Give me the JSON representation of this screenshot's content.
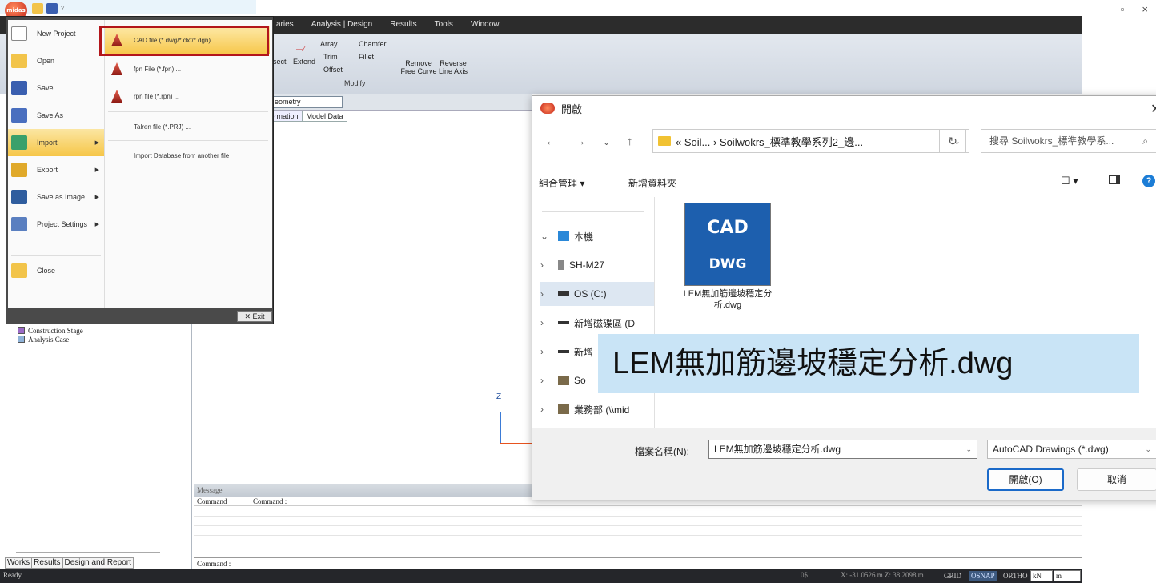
{
  "titlebar": {
    "qat_sep": "▿",
    "minimize": "–",
    "restore": "▫",
    "close": "×"
  },
  "app_logo": "midas",
  "menubar": [
    "aries",
    "Analysis | Design",
    "Results",
    "Tools",
    "Window"
  ],
  "ribbon": {
    "intersect": "rsect",
    "extend": "Extend",
    "array": "Array",
    "chamfer": "Chamfer",
    "trim": "Trim",
    "fillet": "Fillet",
    "offset": "Offset",
    "remove_free_curve": "Remove Free Curve",
    "reverse_line_axis": "Reverse Line Axis",
    "group": "Modify"
  },
  "geometry_select": "eometry",
  "tabs": [
    "formation",
    "Model Data"
  ],
  "app_menu": {
    "items": [
      "New Project",
      "Open",
      "Save",
      "Save As",
      "Import",
      "Export",
      "Save as Image",
      "Project Settings",
      "Close"
    ],
    "submenu": [
      "CAD file (*.dwg/*.dxf/*.dgn) ...",
      "fpn File (*.fpn) ...",
      "rpn file (*.rpn) ...",
      "Talren file (*.PRJ) ...",
      "Import Database from another file"
    ],
    "exit": "Exit"
  },
  "tree": [
    "Construction Stage",
    "Analysis Case"
  ],
  "bottom_tabs": [
    "Works",
    "Results",
    "Design and Report"
  ],
  "axis": {
    "z": "Z"
  },
  "message": {
    "header": "Message",
    "col1": "Command",
    "col2": "Command :",
    "cmd": "Command :"
  },
  "status": {
    "ready": "Ready",
    "zero": "0$",
    "coord": "X: -31.0526 m  Z: 38.2098 m",
    "grid": "GRID",
    "osnap": "OSNAP",
    "ortho": "ORTHO",
    "force_unit": "kN",
    "length_unit": "m"
  },
  "dialog": {
    "title": "開啟",
    "address": "«  Soil...  ›  Soilwokrs_標準教學系列2_邊...",
    "search_placeholder": "搜尋 Soilwokrs_標準教學系...",
    "organize": "組合管理 ▾",
    "new_folder": "新增資料夾",
    "nav": [
      {
        "label": "本機",
        "chev": "⌄"
      },
      {
        "label": "SH-M27",
        "chev": "›"
      },
      {
        "label": "OS (C:)",
        "chev": "›"
      },
      {
        "label": "新增磁碟區 (D",
        "chev": "›"
      },
      {
        "label": "新增",
        "chev": "›"
      },
      {
        "label": "So",
        "chev": "›"
      },
      {
        "label": "業務部 (\\\\mid",
        "chev": "›"
      }
    ],
    "file": {
      "icon_top": "CAD",
      "icon_bottom": "DWG",
      "name": "LEM無加筋邊坡穩定分析.dwg"
    },
    "filename_label": "檔案名稱(N):",
    "filename_value": "LEM無加筋邊坡穩定分析.dwg",
    "filetype": "AutoCAD Drawings (*.dwg)",
    "open": "開啟(O)",
    "cancel": "取消"
  },
  "callout": "LEM無加筋邊坡穩定分析.dwg",
  "colors": {
    "accent": "#1b6ac9",
    "highlight": "#f6c648",
    "red_box": "#b3161b"
  }
}
